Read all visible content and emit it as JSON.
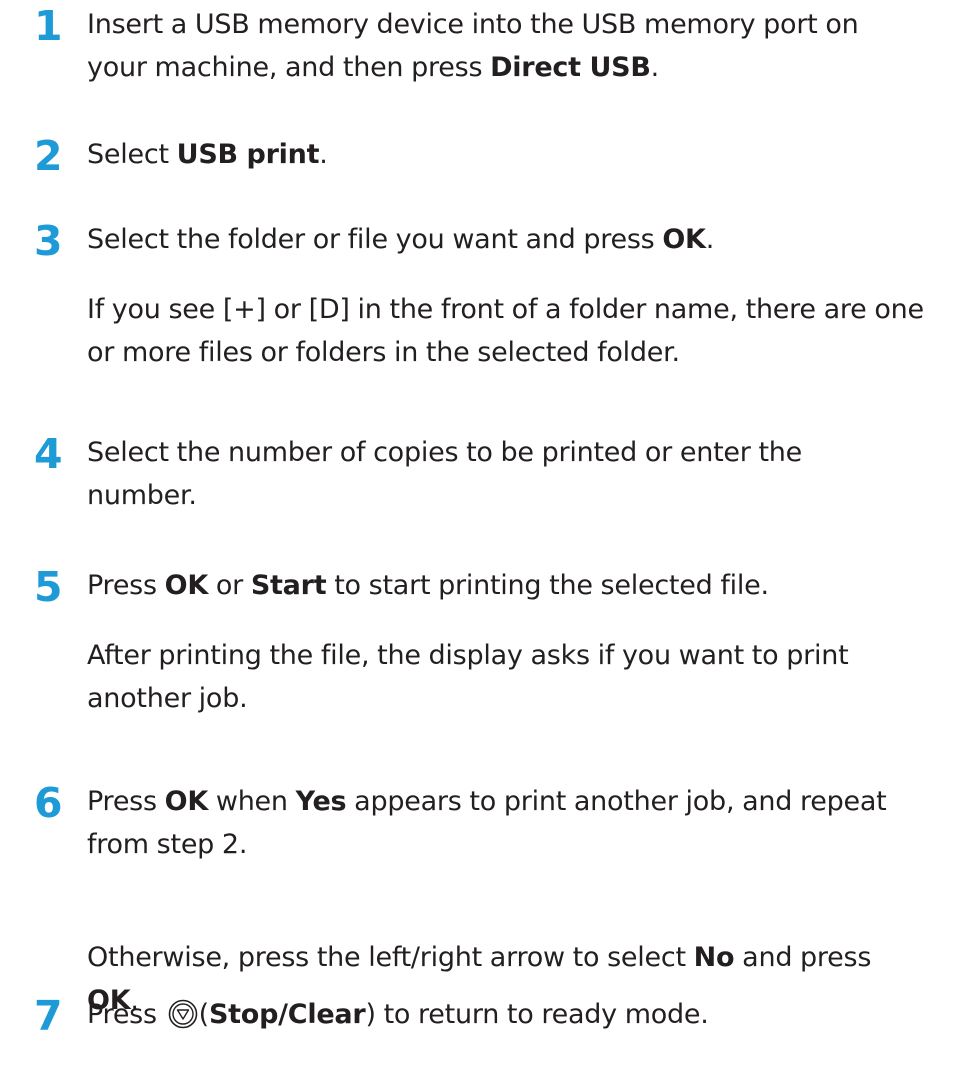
{
  "steps": [
    {
      "number": "1",
      "paragraphs": [
        {
          "lines": [
            [
              {
                "text": "Insert a USB memory device into the USB memory port on"
              }
            ],
            [
              {
                "text": "your machine, and then press "
              },
              {
                "text": "Direct USB",
                "bold": true
              },
              {
                "text": "."
              }
            ]
          ]
        }
      ]
    },
    {
      "number": "2",
      "paragraphs": [
        {
          "lines": [
            [
              {
                "text": "Select "
              },
              {
                "text": "USB print",
                "bold": true
              },
              {
                "text": "."
              }
            ]
          ]
        }
      ]
    },
    {
      "number": "3",
      "paragraphs": [
        {
          "lines": [
            [
              {
                "text": "Select the folder or file you want and press "
              },
              {
                "text": "OK",
                "bold": true
              },
              {
                "text": "."
              }
            ]
          ]
        },
        {
          "lines": [
            [
              {
                "text": "If you see [+] or [D] in the front of a folder name, there are one"
              }
            ],
            [
              {
                "text": "or more files or folders in the selected folder."
              }
            ]
          ]
        }
      ]
    },
    {
      "number": "4",
      "paragraphs": [
        {
          "lines": [
            [
              {
                "text": "Select the number of copies to be printed or enter the"
              }
            ],
            [
              {
                "text": "number."
              }
            ]
          ]
        }
      ]
    },
    {
      "number": "5",
      "paragraphs": [
        {
          "lines": [
            [
              {
                "text": "Press "
              },
              {
                "text": "OK",
                "bold": true
              },
              {
                "text": " or "
              },
              {
                "text": "Start",
                "bold": true
              },
              {
                "text": " to start printing the selected file."
              }
            ]
          ]
        },
        {
          "lines": [
            [
              {
                "text": "After printing the file, the display asks if you want to print"
              }
            ],
            [
              {
                "text": "another job."
              }
            ]
          ]
        }
      ]
    },
    {
      "number": "6",
      "paragraphs": [
        {
          "lines": [
            [
              {
                "text": "Press "
              },
              {
                "text": "OK",
                "bold": true
              },
              {
                "text": " when "
              },
              {
                "text": "Yes",
                "bold": true
              },
              {
                "text": " appears to print another job, and repeat"
              }
            ],
            [
              {
                "text": "from step 2."
              }
            ]
          ]
        },
        {
          "lines": [
            [
              {
                "text": "Otherwise, press the left/right arrow to select "
              },
              {
                "text": "No",
                "bold": true
              },
              {
                "text": " and press"
              }
            ],
            [
              {
                "text": "OK",
                "bold": true
              },
              {
                "text": "."
              }
            ]
          ]
        }
      ]
    },
    {
      "number": "7",
      "paragraphs": [
        {
          "lines": [
            [
              {
                "text": "Press "
              },
              {
                "icon": "stop-clear-icon"
              },
              {
                "text": "("
              },
              {
                "text": "Stop/Clear",
                "bold": true
              },
              {
                "text": ") to return to ready mode."
              }
            ]
          ]
        }
      ]
    }
  ],
  "colors": {
    "step_number": "#1e9bd6",
    "body_text": "#231f20"
  }
}
